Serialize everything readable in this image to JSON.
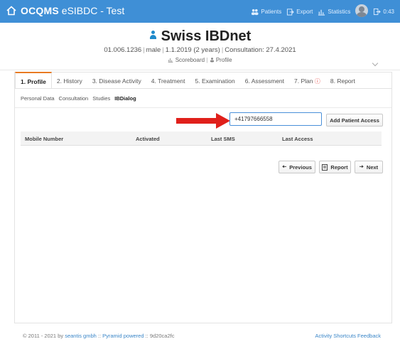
{
  "app": {
    "brand_bold": "OCQMS",
    "brand_rest": " eSIBDC - Test"
  },
  "topnav": {
    "patients": "Patients",
    "export": "Export",
    "statistics": "Statistics",
    "time": "0:43"
  },
  "header": {
    "title": "Swiss IBDnet",
    "patient_id": "01.006.1236",
    "sex": "male",
    "dob": "1.1.2019 (2 years)",
    "consultation": "Consultation: 27.4.2021",
    "scoreboard": "Scoreboard",
    "profile": "Profile"
  },
  "tabs": [
    {
      "label": "1. Profile"
    },
    {
      "label": "2. History"
    },
    {
      "label": "3. Disease Activity"
    },
    {
      "label": "4. Treatment"
    },
    {
      "label": "5. Examination"
    },
    {
      "label": "6. Assessment"
    },
    {
      "label": "7. Plan"
    },
    {
      "label": "8. Report"
    }
  ],
  "subtabs": [
    "Personal Data",
    "Consultation",
    "Studies",
    "IBDialog"
  ],
  "form": {
    "phone_value": "+41797666558",
    "add_button": "Add Patient Access"
  },
  "table": {
    "headers": [
      "Mobile Number",
      "Activated",
      "Last SMS",
      "Last Access"
    ]
  },
  "buttons": {
    "previous": "Previous",
    "report": "Report",
    "next": "Next"
  },
  "footer": {
    "copyright": "© 2011 - 2021 by ",
    "company": "seantis gmbh",
    "sep1": " :: ",
    "powered": "Pyramid powered",
    "build": " :: 9d20ca2fc",
    "right": "Activity Shortcuts Feedback"
  },
  "colors": {
    "topbar": "#3f8fd6",
    "accent_tab": "#e87a23",
    "arrow": "#e0201b",
    "link": "#3a86c8"
  }
}
